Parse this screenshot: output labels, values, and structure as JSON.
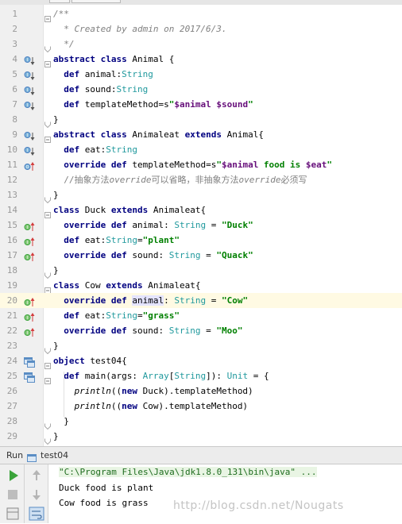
{
  "code_lines": [
    "/**",
    "  * Created by admin on 2017/6/3.",
    "  */",
    "abstract class Animal {",
    "  def animal:String",
    "  def sound:String",
    "  def templateMethod=s\"$animal $sound\"",
    "}",
    "abstract class Animaleat extends Animal{",
    "  def eat:String",
    "  override def templateMethod=s\"$animal food is $eat\"",
    "  //抽象方法override可以省略，非抽象方法override必须写",
    "}",
    "class Duck extends Animaleat{",
    "  override def animal: String = \"Duck\"",
    "  def eat:String=\"plant\"",
    "  override def sound: String = \"Quack\"",
    "}",
    "class Cow extends Animaleat{",
    "  override def animal: String = \"Cow\"",
    "  def eat:String=\"grass\"",
    "  override def sound: String = \"Moo\"",
    "}",
    "object test04{",
    "  def main(args: Array[String]): Unit = {",
    "    println((new Duck).templateMethod)",
    "    println((new Cow).templateMethod)",
    "  }",
    "}"
  ],
  "line_numbers": [
    "1",
    "2",
    "3",
    "4",
    "5",
    "6",
    "7",
    "8",
    "9",
    "10",
    "11",
    "12",
    "13",
    "14",
    "15",
    "16",
    "17",
    "18",
    "19",
    "20",
    "21",
    "22",
    "23",
    "24",
    "25",
    "26",
    "27",
    "28",
    "29"
  ],
  "gutter_icons": {
    "4": "implemented-down-icon",
    "5": "implemented-down-icon",
    "6": "implemented-down-icon",
    "7": "implemented-down-icon",
    "9": "implemented-down-icon",
    "10": "implemented-down-icon",
    "11": "overriding-up-icon",
    "15": "implementing-up-icon",
    "16": "implementing-up-icon",
    "17": "implementing-up-icon",
    "20": "implementing-up-icon",
    "21": "implementing-up-icon",
    "22": "implementing-up-icon",
    "24": "run-object-icon",
    "25": "run-method-icon"
  },
  "current_line": 20,
  "run_panel": {
    "label": "Run",
    "tab_label": "test04",
    "tab_icon": "run-config-icon"
  },
  "toolbar": {
    "buttons": [
      "rerun-icon",
      "up-arrow-icon",
      "stop-icon",
      "down-arrow-icon",
      "layout-icon",
      "soft-wrap-icon"
    ]
  },
  "console": {
    "command": "\"C:\\Program Files\\Java\\jdk1.8.0_131\\bin\\java\" ...",
    "output": [
      "Duck food is plant",
      "Cow food is grass"
    ]
  },
  "watermark": "http://blog.csdn.net/Nougats",
  "colors": {
    "keyword": "#000080",
    "string": "#008000",
    "type": "#20999d",
    "comment": "#808080",
    "interp_var": "#660e7a",
    "line_highlight": "#fffae3",
    "run_green": "#3aa33a"
  }
}
